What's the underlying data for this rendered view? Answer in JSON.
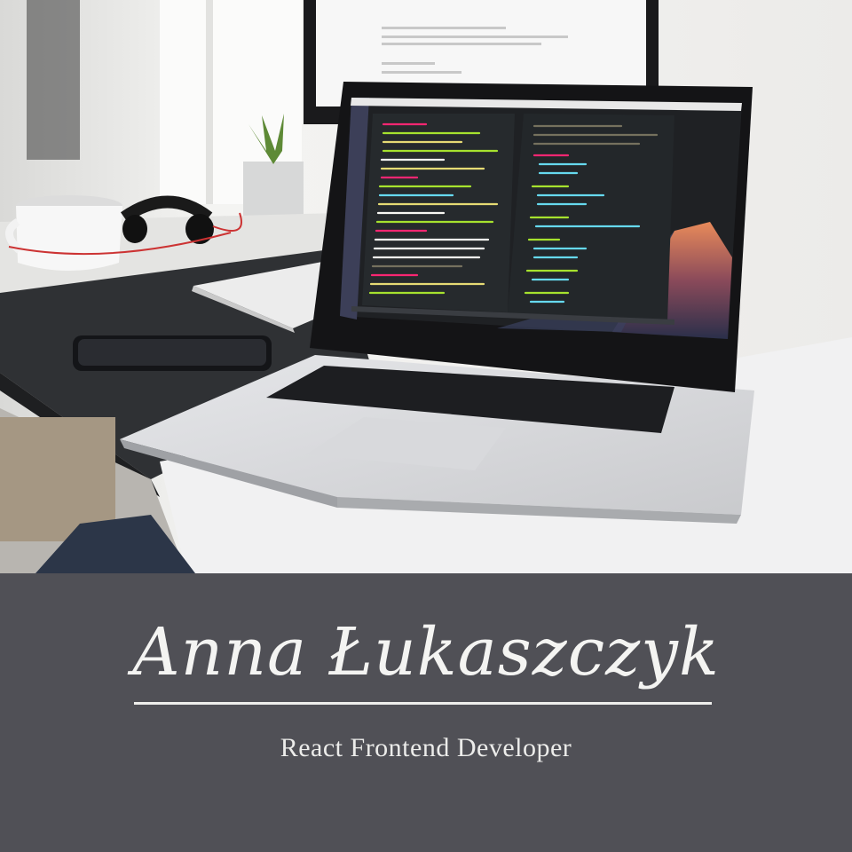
{
  "profile": {
    "name": "Anna Łukaszczyk",
    "title": "React Frontend Developer"
  },
  "colors": {
    "banner": "#505056",
    "text": "#f4f4f2"
  }
}
